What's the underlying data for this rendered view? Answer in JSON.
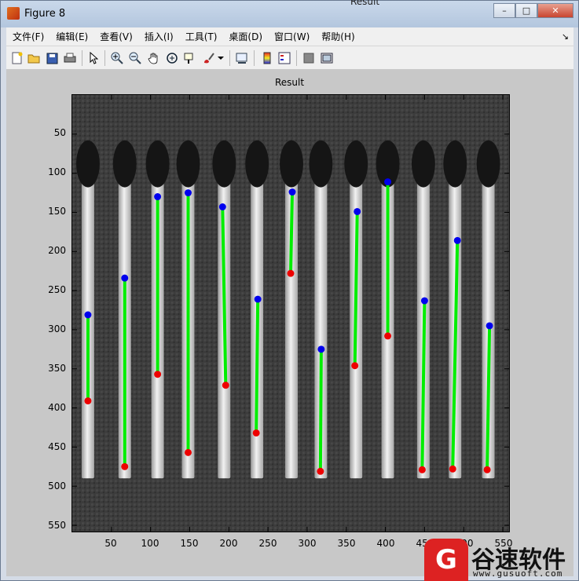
{
  "window": {
    "title": "Figure 8",
    "background_window_title": "Result",
    "buttons": [
      "–",
      "□",
      "✕"
    ]
  },
  "menubar": {
    "items": [
      "文件(F)",
      "编辑(E)",
      "查看(V)",
      "插入(I)",
      "工具(T)",
      "桌面(D)",
      "窗口(W)",
      "帮助(H)"
    ],
    "overflow_arrow": "↘"
  },
  "toolbar": {
    "icons": [
      "new-figure-icon",
      "open-file-icon",
      "save-icon",
      "print-icon",
      "edit-plot-arrow-icon",
      "zoom-in-icon",
      "zoom-out-icon",
      "pan-hand-icon",
      "rotate-3d-icon",
      "data-cursor-icon",
      "brush-icon",
      "brush-dropdown-icon",
      "link-plot-icon",
      "colorbar-icon",
      "legend-icon",
      "hide-plot-tools-icon",
      "show-plot-tools-icon"
    ]
  },
  "axes": {
    "title": "Result",
    "yticks": [
      "50",
      "100",
      "150",
      "200",
      "250",
      "300",
      "350",
      "400",
      "450",
      "500",
      "550"
    ],
    "xticks": [
      "50",
      "100",
      "150",
      "200",
      "250",
      "300",
      "350",
      "400",
      "450",
      "500",
      "550"
    ]
  },
  "chart_data": {
    "type": "scatter",
    "title": "Result",
    "xlim": [
      0,
      558
    ],
    "ylim": [
      558,
      0
    ],
    "series": [
      {
        "segments": [
          {
            "top": [
              20,
              281
            ],
            "bottom": [
              20,
              391
            ]
          },
          {
            "top": [
              67,
              234
            ],
            "bottom": [
              67,
              475
            ]
          },
          {
            "top": [
              109,
              130
            ],
            "bottom": [
              109,
              357
            ]
          },
          {
            "top": [
              148,
              125
            ],
            "bottom": [
              148,
              457
            ]
          },
          {
            "top": [
              192,
              143
            ],
            "bottom": [
              196,
              371
            ]
          },
          {
            "top": [
              237,
              261
            ],
            "bottom": [
              235,
              432
            ]
          },
          {
            "top": [
              281,
              124
            ],
            "bottom": [
              279,
              228
            ]
          },
          {
            "top": [
              318,
              325
            ],
            "bottom": [
              317,
              481
            ]
          },
          {
            "top": [
              364,
              149
            ],
            "bottom": [
              361,
              346
            ]
          },
          {
            "top": [
              403,
              111
            ],
            "bottom": [
              403,
              308
            ]
          },
          {
            "top": [
              450,
              263
            ],
            "bottom": [
              447,
              479
            ]
          },
          {
            "top": [
              492,
              186
            ],
            "bottom": [
              486,
              478
            ]
          },
          {
            "top": [
              533,
              295
            ],
            "bottom": [
              530,
              479
            ]
          }
        ]
      }
    ],
    "colors": {
      "line": "#00ee00",
      "top_marker": "#0000ee",
      "bottom_marker": "#ee0000"
    }
  },
  "watermark": {
    "name": "谷速软件",
    "url": "www.gusuoft.com"
  }
}
